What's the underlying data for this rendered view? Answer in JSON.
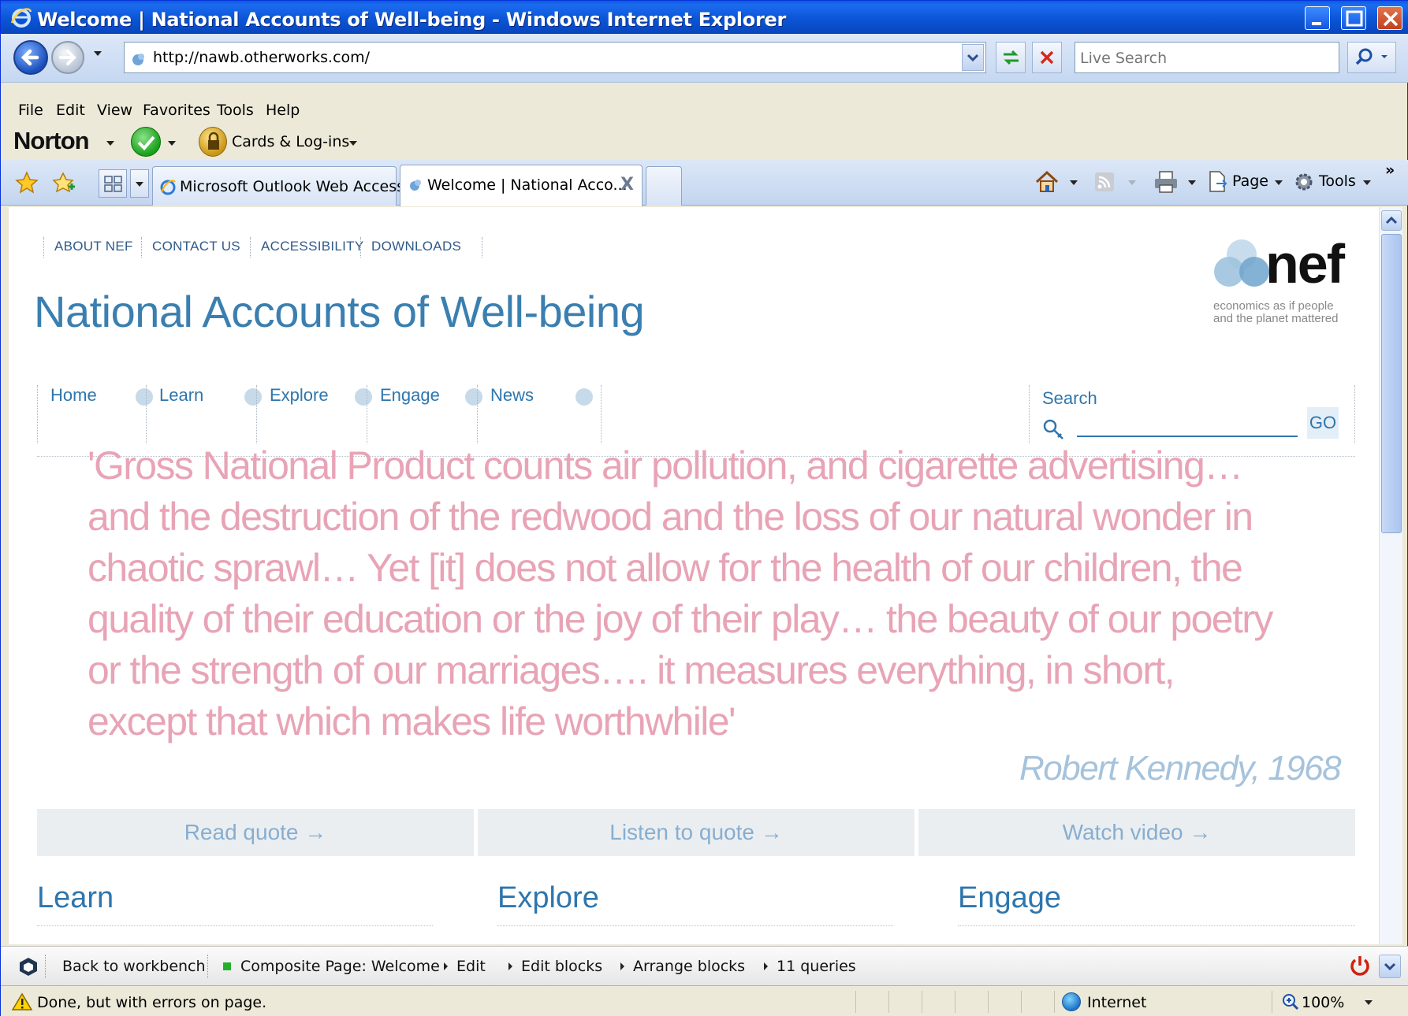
{
  "window": {
    "title": "Welcome | National Accounts of Well-being - Windows Internet Explorer"
  },
  "address_bar": {
    "url": "http://nawb.otherworks.com/",
    "search_placeholder": "Live Search"
  },
  "menu": {
    "items": [
      "File",
      "Edit",
      "View",
      "Favorites",
      "Tools",
      "Help"
    ]
  },
  "norton": {
    "brand": "Norton",
    "cards_label": "Cards & Log-ins"
  },
  "tabs": {
    "items": [
      {
        "label": "Microsoft Outlook Web Access"
      },
      {
        "label": "Welcome | National Acco..."
      }
    ],
    "close_glyph": "X",
    "page_label": "Page",
    "tools_label": "Tools",
    "overflow": "»"
  },
  "site": {
    "top_links": [
      "ABOUT NEF",
      "CONTACT US",
      "ACCESSIBILITY",
      "DOWNLOADS"
    ],
    "logo": {
      "name": "nef",
      "tagline_line1": "economics as if people",
      "tagline_line2": "and the planet mattered"
    },
    "title": "National Accounts of Well-being",
    "nav": [
      "Home",
      "Learn",
      "Explore",
      "Engage",
      "News"
    ],
    "search": {
      "label": "Search",
      "go": "GO"
    },
    "quote": {
      "lines": [
        "'Gross National Product counts air pollution, and cigarette advertising…",
        "and the destruction of the redwood and the loss of our natural wonder in",
        "chaotic sprawl… Yet [it] does not allow for the health of our children, the",
        "quality of their education or the joy of their play… the beauty of our poetry",
        "or the strength of our marriages…. it measures everything, in short,",
        "except that which makes life worthwhile'"
      ],
      "author": "Robert Kennedy, 1968"
    },
    "quote_actions": [
      "Read quote →",
      "Listen to quote →",
      "Watch video →"
    ],
    "sections": [
      "Learn",
      "Explore",
      "Engage"
    ],
    "colors": {
      "title_blue": "#3a7fb0",
      "link_blue": "#2e76ad",
      "quote_pink": "#e8a4b6",
      "author_blue": "#a6c3dc"
    }
  },
  "workbench": {
    "items": [
      "Back to workbench",
      "Composite Page: Welcome",
      "Edit",
      "Edit blocks",
      "Arrange blocks",
      "11 queries"
    ]
  },
  "status": {
    "text": "Done, but with errors on page.",
    "zone": "Internet",
    "zoom": "100%"
  }
}
